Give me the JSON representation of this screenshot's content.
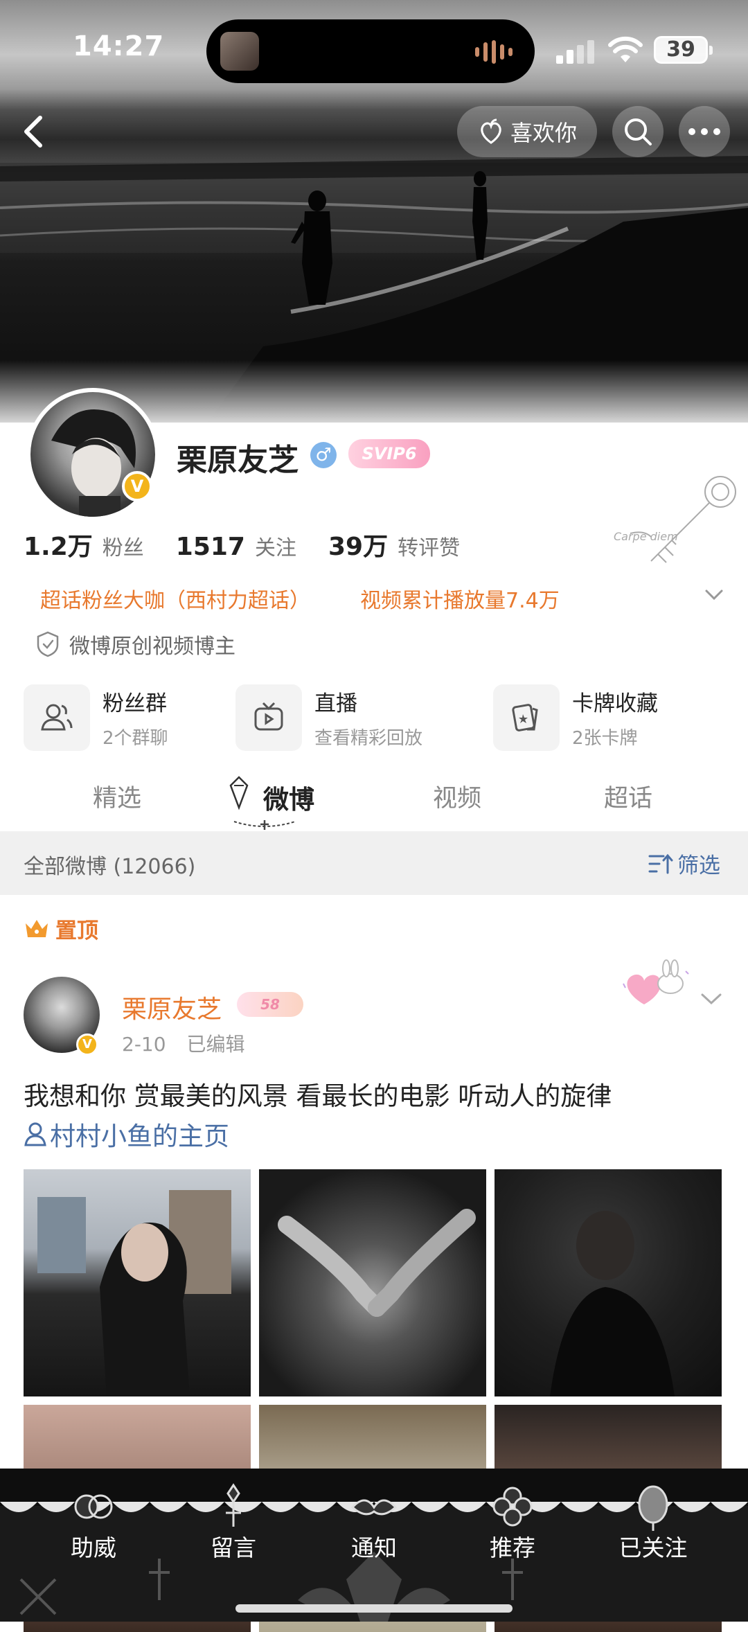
{
  "status_bar": {
    "time": "14:27",
    "battery": "39"
  },
  "header": {
    "like_label": "喜欢你"
  },
  "profile": {
    "name": "栗原友芝",
    "gender_symbol": "♂",
    "vip_label": "SVIP6",
    "verified_mark": "V",
    "stats": [
      {
        "value": "1.2万",
        "label": "粉丝"
      },
      {
        "value": "1517",
        "label": "关注"
      },
      {
        "value": "39万",
        "label": "转评赞"
      }
    ],
    "tags": [
      "超话粉丝大咖（西村力超话）",
      "视频累计播放量7.4万"
    ],
    "certification": "微博原创视频博主",
    "cards": [
      {
        "title": "粉丝群",
        "subtitle": "2个群聊",
        "icon": "fans-group-icon"
      },
      {
        "title": "直播",
        "subtitle": "查看精彩回放",
        "icon": "live-tv-icon"
      },
      {
        "title": "卡牌收藏",
        "subtitle": "2张卡牌",
        "icon": "card-collection-icon"
      }
    ]
  },
  "tabs": [
    {
      "label": "精选"
    },
    {
      "label": "微博"
    },
    {
      "label": "视频"
    },
    {
      "label": "超话"
    }
  ],
  "active_tab": "微博",
  "filter_bar": {
    "all_label": "全部微博 (12066)",
    "filter_label": "筛选"
  },
  "pinned": {
    "label": "置顶"
  },
  "post": {
    "author": "栗原友芝",
    "level_badge": "58",
    "date": "2-10",
    "edited": "已编辑",
    "text": "我想和你 赏最美的风景 看最长的电影 听动人的旋律",
    "link_text": "村村小鱼的主页"
  },
  "bottom_nav": [
    {
      "label": "助威"
    },
    {
      "label": "留言"
    },
    {
      "label": "通知"
    },
    {
      "label": "推荐"
    },
    {
      "label": "已关注"
    }
  ]
}
